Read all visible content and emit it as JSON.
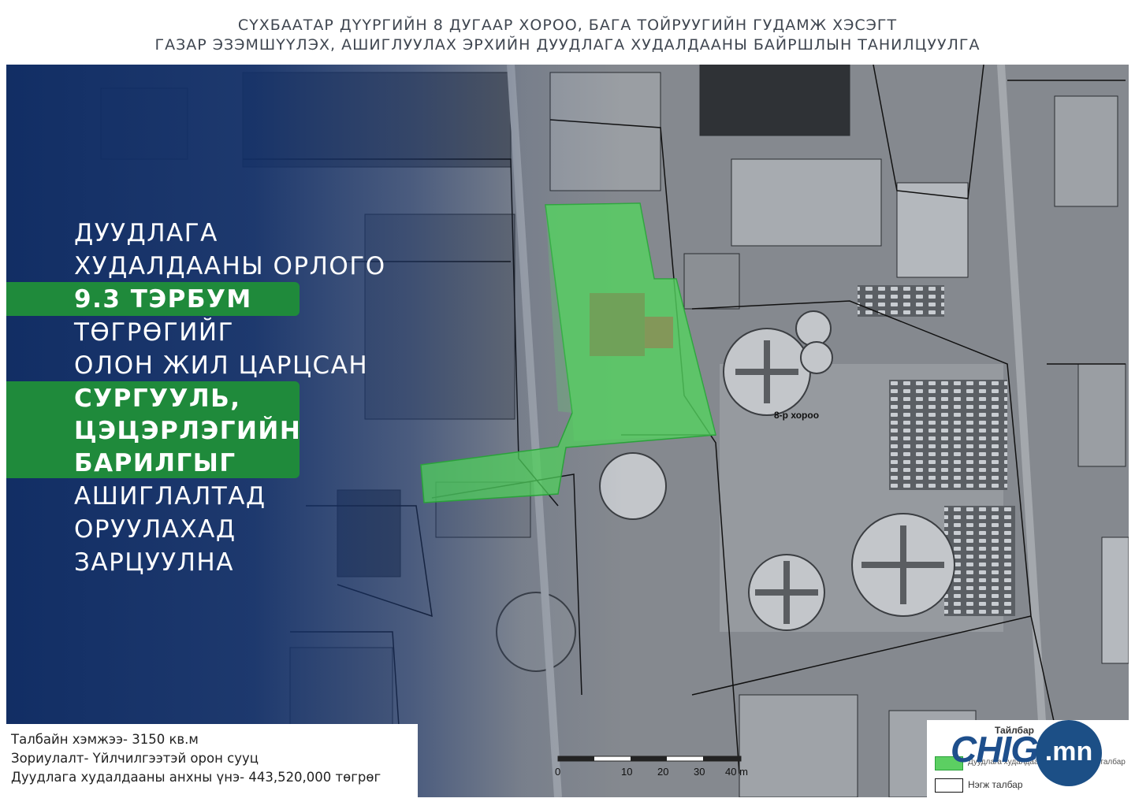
{
  "header": {
    "title_line1": "СҮХБААТАР ДҮҮРГИЙН 8 ДУГААР ХОРОО, БАГА ТОЙРУУГИЙН ГУДАМЖ ХЭСЭГТ",
    "title_line2": "ГАЗАР ЭЗЭМШҮҮЛЭХ, АШИГЛУУЛАХ ЭРХИЙН ДУУДЛАГА ХУДАЛДААНЫ БАЙРШЛЫН ТАНИЛЦУУЛГА"
  },
  "headline": {
    "lines": [
      {
        "text": "ДУУДЛАГА",
        "highlight": false
      },
      {
        "text": "ХУДАЛДААНЫ ОРЛОГО",
        "highlight": false
      },
      {
        "text": "9.3 ТЭРБУМ",
        "highlight": true
      },
      {
        "text": "ТӨГРӨГИЙГ",
        "highlight": false
      },
      {
        "text": "ОЛОН ЖИЛ ЦАРЦСАН",
        "highlight": false
      },
      {
        "text": "СУРГУУЛЬ,",
        "highlight": true
      },
      {
        "text": "ЦЭЦЭРЛЭГИЙН",
        "highlight": true
      },
      {
        "text": "БАРИЛГЫГ",
        "highlight": true
      },
      {
        "text": "АШИГЛАЛТАД",
        "highlight": false
      },
      {
        "text": "ОРУУЛАХАД",
        "highlight": false
      },
      {
        "text": "ЗАРЦУУЛНА",
        "highlight": false
      }
    ]
  },
  "map": {
    "district_label": "8-р хороо",
    "parcel_color": "#4fd35a",
    "overlay_color": "#0d2a5e"
  },
  "info": {
    "area": "Талбайн хэмжээ- 3150 кв.м",
    "purpose": "Зориулалт- Үйлчилгээтэй орон сууц",
    "price": "Дуудлага худалдааны анхны үнэ- 443,520,000 төгрөг"
  },
  "scale": {
    "ticks": [
      "0",
      "10",
      "20",
      "30",
      "40 m"
    ]
  },
  "legend": {
    "title": "Тайлбар",
    "items": [
      {
        "label": "Дуудлага худалдаанд оруулах нэгж талбар",
        "color": "#5ccf62"
      },
      {
        "label": "Нэгж талбар",
        "color": "#ffffff"
      }
    ]
  },
  "logo": {
    "brand": "CHIG",
    "tld": ".mn"
  },
  "colors": {
    "accent_green": "#1f8a3b",
    "brand_blue": "#1c4f86"
  }
}
